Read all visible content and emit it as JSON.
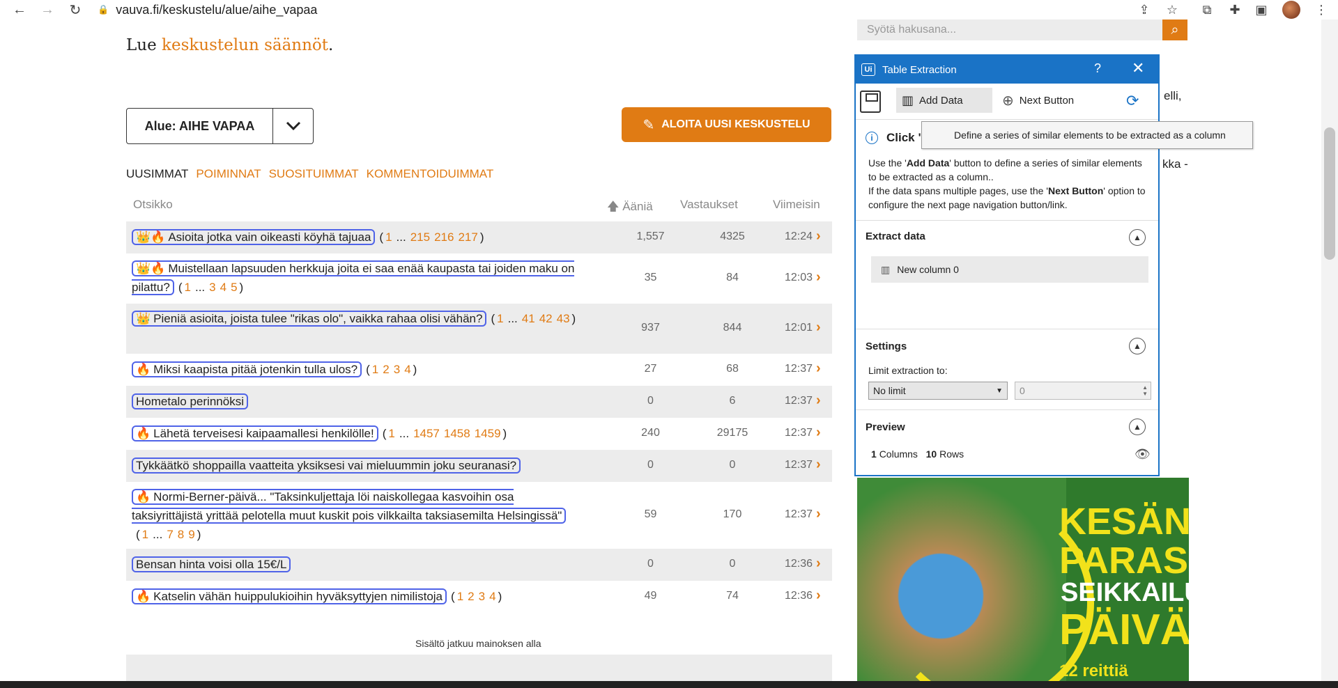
{
  "browser": {
    "url": "vauva.fi/keskustelu/alue/aihe_vapaa"
  },
  "page": {
    "rules_prefix": "Lue ",
    "rules_link": "keskustelun säännöt",
    "rules_suffix": ".",
    "area_select": "Alue: AIHE VAPAA",
    "new_thread_button": "ALOITA UUSI KESKUSTELU",
    "tabs": [
      "UUSIMMAT",
      "POIMINNAT",
      "SUOSITUIMMAT",
      "KOMMENTOIDUIMMAT"
    ],
    "columns": {
      "title": "Otsikko",
      "votes": "Ääniä",
      "answers": "Vastaukset",
      "latest": "Viimeisin"
    },
    "threads": [
      {
        "crown": "👑",
        "fire": "🔥",
        "title": "Asioita jotka vain oikeasti köyhä tajuaa",
        "pages": [
          "1",
          "...",
          "215",
          "216",
          "217"
        ],
        "votes": "1,557",
        "answers": "4325",
        "time": "12:24"
      },
      {
        "crown": "👑",
        "fire": "🔥",
        "title": "Muistellaan lapsuuden herkkuja joita ei saa enää kaupasta tai joiden maku on pilattu?",
        "pages": [
          "1",
          "...",
          "3",
          "4",
          "5"
        ],
        "votes": "35",
        "answers": "84",
        "time": "12:03"
      },
      {
        "crown": "👑",
        "fire": "",
        "title": "Pieniä asioita, joista tulee \"rikas olo\", vaikka rahaa olisi vähän?",
        "pages": [
          "1",
          "...",
          "41",
          "42",
          "43"
        ],
        "votes": "937",
        "answers": "844",
        "time": "12:01"
      },
      {
        "crown": "",
        "fire": "🔥",
        "title": "Miksi kaapista pitää jotenkin tulla ulos?",
        "pages": [
          "1",
          "2",
          "3",
          "4"
        ],
        "votes": "27",
        "answers": "68",
        "time": "12:37"
      },
      {
        "crown": "",
        "fire": "",
        "title": "Hometalo perinnöksi",
        "pages": [],
        "votes": "0",
        "answers": "6",
        "time": "12:37"
      },
      {
        "crown": "",
        "fire": "🔥",
        "title": "Lähetä terveisesi kaipaamallesi henkilölle!",
        "pages": [
          "1",
          "...",
          "1457",
          "1458",
          "1459"
        ],
        "votes": "240",
        "answers": "29175",
        "time": "12:37"
      },
      {
        "crown": "",
        "fire": "",
        "title": "Tykkäätkö shoppailla vaatteita yksiksesi vai mieluummin joku seuranasi?",
        "pages": [],
        "votes": "0",
        "answers": "0",
        "time": "12:37"
      },
      {
        "crown": "",
        "fire": "🔥",
        "title": "Normi-Berner-päivä... \"Taksinkuljettaja löi naiskollegaa kasvoihin osa taksiyrittäjistä yrittää pelotella muut kuskit pois vilkkailta taksiasemilta Helsingissä\"",
        "pages": [
          "1",
          "...",
          "7",
          "8",
          "9"
        ],
        "votes": "59",
        "answers": "170",
        "time": "12:37"
      },
      {
        "crown": "",
        "fire": "",
        "title": "Bensan hinta voisi olla 15€/L",
        "pages": [],
        "votes": "0",
        "answers": "0",
        "time": "12:36"
      },
      {
        "crown": "",
        "fire": "🔥",
        "title": "Katselin vähän huippulukioihin hyväksyttyjen nimilistoja",
        "pages": [
          "1",
          "2",
          "3",
          "4"
        ],
        "votes": "49",
        "answers": "74",
        "time": "12:36"
      }
    ],
    "ad_note": "Sisältö jatkuu mainoksen alla",
    "search_placeholder": "Syötä hakusana...",
    "sidebar_peek": [
      "elli,",
      "kka -"
    ],
    "banner": {
      "line1": "KESÄN",
      "line2": "PARAS",
      "line3": "SEIKKAILU-",
      "line4": "PÄIVÄ",
      "line5": "12 reittiä"
    }
  },
  "dialog": {
    "title": "Table Extraction",
    "help": "?",
    "add_data": "Add Data",
    "next_button": "Next Button",
    "tooltip": "Define a series of similar elements to be extracted as a column",
    "info_heading": "Click \"Add",
    "desc_line1_a": "Use the '",
    "desc_line1_b": "Add Data",
    "desc_line1_c": "' button to define a series of similar elements to be extracted as a column..",
    "desc_line2_a": "If the data spans multiple pages, use the '",
    "desc_line2_b": "Next Button",
    "desc_line2_c": "' option to configure the next page navigation button/link.",
    "extract_heading": "Extract data",
    "new_column": "New column 0",
    "settings_heading": "Settings",
    "limit_label": "Limit extraction to:",
    "limit_value": "No limit",
    "limit_number": "0",
    "preview_heading": "Preview",
    "preview_columns": "1",
    "preview_columns_label": "Columns",
    "preview_rows": "10",
    "preview_rows_label": "Rows"
  },
  "colors": {
    "accent": "#e07b14",
    "dialog_blue": "#1a73c6",
    "highlight": "#4f63e8"
  }
}
